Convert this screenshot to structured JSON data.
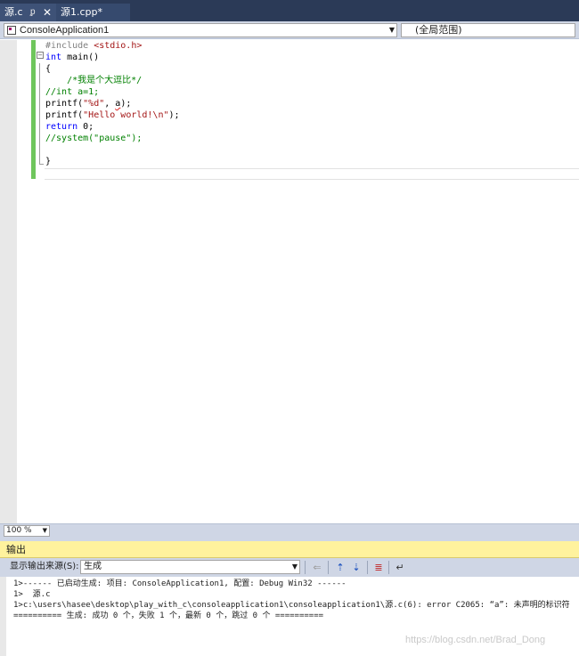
{
  "tabs": [
    {
      "label": "源.c",
      "active": true
    },
    {
      "label": "源1.cpp*",
      "active": false
    }
  ],
  "tab_pin_glyph": "ᵱ",
  "tab_close_glyph": "✕",
  "navbar": {
    "project": "ConsoleApplication1",
    "scope": "(全局范围)"
  },
  "code": {
    "l1": {
      "a": "#include ",
      "b": "<stdio.h>"
    },
    "l2": {
      "a": "int",
      "b": " main()"
    },
    "l3": "{",
    "l4": "    /*我是个大逗比*/",
    "l5": "//int a=1;",
    "l6": {
      "a": "printf(",
      "b": "\"%d\"",
      "c": ", ",
      "d": "a",
      "e": ");"
    },
    "l7": {
      "a": "printf(",
      "b": "\"Hello world!\\n\"",
      "c": ");"
    },
    "l8": {
      "a": "return",
      "b": " 0;"
    },
    "l9": "//system(\"pause\");",
    "l10": "",
    "l11": "}"
  },
  "zoom": "100 %",
  "output": {
    "title": "输出",
    "source_label": "显示输出来源(S):",
    "source_value": "生成",
    "lines": [
      "1>------ 已启动生成: 项目: ConsoleApplication1, 配置: Debug Win32 ------",
      "1>  源.c",
      "1>c:\\users\\hasee\\desktop\\play_with_c\\consoleapplication1\\consoleapplication1\\源.c(6): error C2065: “a”: 未声明的标识符",
      "========== 生成: 成功 0 个，失败 1 个，最新 0 个，跳过 0 个 =========="
    ]
  },
  "watermark": "https://blog.csdn.net/Brad_Dong",
  "colors": {
    "keyword": "#0000ff",
    "string": "#a31515",
    "comment": "#008000",
    "preprocessor": "#808080",
    "output_title_bg": "#fff29d",
    "change_bar": "#6fc65c"
  },
  "icons": {
    "project": "cpp-project-icon",
    "tool1": "clear-find-icon",
    "tool2": "go-to-previous-message-icon",
    "tool3": "go-to-next-message-icon",
    "tool4": "clear-all-icon",
    "tool5": "toggle-word-wrap-icon"
  }
}
